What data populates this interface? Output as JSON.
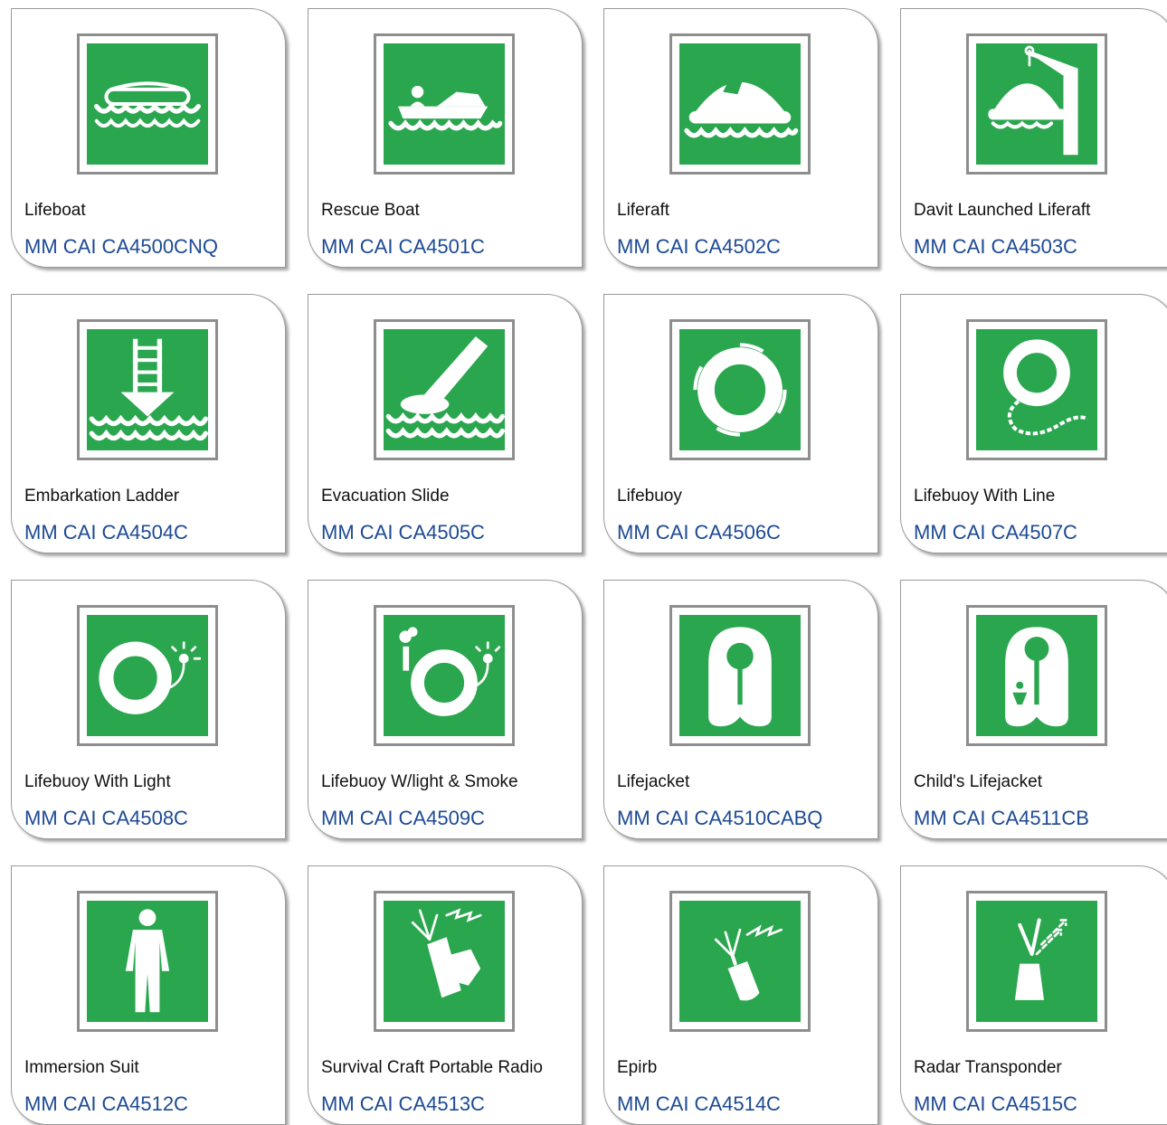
{
  "items": [
    {
      "name": "Lifeboat",
      "code": "MM CAI CA4500CNQ",
      "icon": "lifeboat-icon"
    },
    {
      "name": "Rescue Boat",
      "code": "MM CAI CA4501C",
      "icon": "rescue-boat-icon"
    },
    {
      "name": "Liferaft",
      "code": "MM CAI CA4502C",
      "icon": "liferaft-icon"
    },
    {
      "name": "Davit Launched Liferaft",
      "code": "MM CAI CA4503C",
      "icon": "davit-liferaft-icon"
    },
    {
      "name": "Embarkation Ladder",
      "code": "MM CAI CA4504C",
      "icon": "embarkation-ladder-icon"
    },
    {
      "name": "Evacuation Slide",
      "code": "MM CAI CA4505C",
      "icon": "evacuation-slide-icon"
    },
    {
      "name": "Lifebuoy",
      "code": "MM CAI CA4506C",
      "icon": "lifebuoy-icon"
    },
    {
      "name": "Lifebuoy With Line",
      "code": "MM CAI CA4507C",
      "icon": "lifebuoy-line-icon"
    },
    {
      "name": "Lifebuoy With Light",
      "code": "MM CAI CA4508C",
      "icon": "lifebuoy-light-icon"
    },
    {
      "name": "Lifebuoy W/light & Smoke",
      "code": "MM CAI CA4509C",
      "icon": "lifebuoy-light-smoke-icon"
    },
    {
      "name": "Lifejacket",
      "code": "MM CAI CA4510CABQ",
      "icon": "lifejacket-icon"
    },
    {
      "name": "Child's Lifejacket",
      "code": "MM CAI CA4511CB",
      "icon": "childs-lifejacket-icon"
    },
    {
      "name": "Immersion Suit",
      "code": "MM CAI CA4512C",
      "icon": "immersion-suit-icon"
    },
    {
      "name": "Survival Craft Portable Radio",
      "code": "MM CAI CA4513C",
      "icon": "portable-radio-icon"
    },
    {
      "name": "Epirb",
      "code": "MM CAI CA4514C",
      "icon": "epirb-icon"
    },
    {
      "name": "Radar Transponder",
      "code": "MM CAI CA4515C",
      "icon": "radar-transponder-icon"
    }
  ],
  "colors": {
    "sign_green": "#2aa64e",
    "link_blue": "#1c4a94"
  }
}
